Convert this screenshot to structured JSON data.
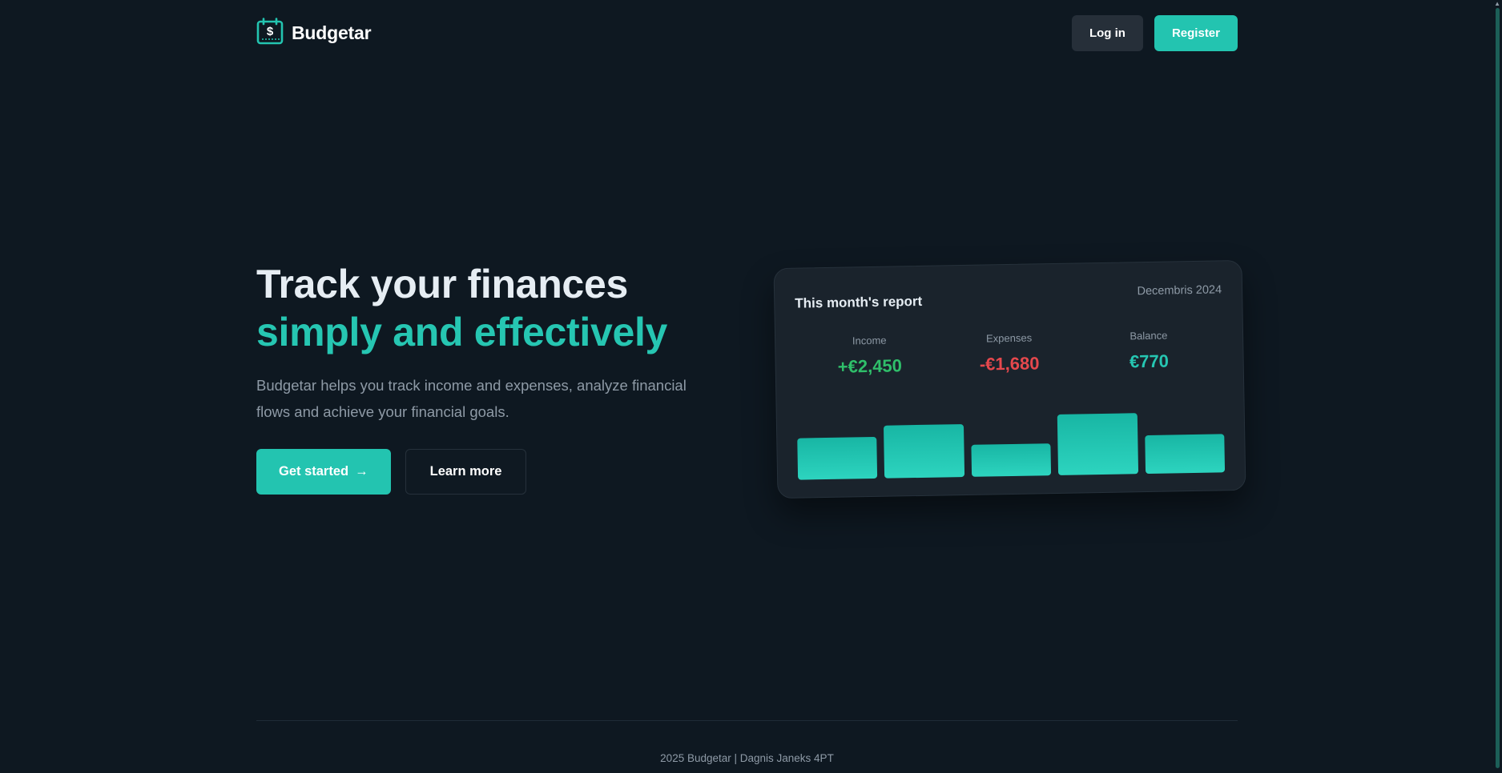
{
  "brand": {
    "name": "Budgetar",
    "icon": "calendar-dollar-icon",
    "accent_color": "#23c4b0"
  },
  "nav": {
    "login_label": "Log in",
    "register_label": "Register"
  },
  "hero": {
    "title_line1": "Track your finances",
    "title_line2": "simply and effectively",
    "description": "Budgetar helps you track income and expenses, analyze financial flows and achieve your financial goals.",
    "primary_label": "Get started",
    "primary_arrow": "→",
    "secondary_label": "Learn more"
  },
  "report": {
    "title": "This month's report",
    "date": "Decembris 2024",
    "stats": [
      {
        "label": "Income",
        "value": "+€2,450",
        "color": "#2fbf6a"
      },
      {
        "label": "Expenses",
        "value": "-€1,680",
        "color": "#e5484d"
      },
      {
        "label": "Balance",
        "value": "€770",
        "color": "#26c6b2"
      }
    ],
    "bar_levels": [
      0.65,
      0.82,
      0.5,
      0.95,
      0.6
    ]
  },
  "footer": {
    "text": "2025 Budgetar | Dagnis Janeks 4PT"
  }
}
